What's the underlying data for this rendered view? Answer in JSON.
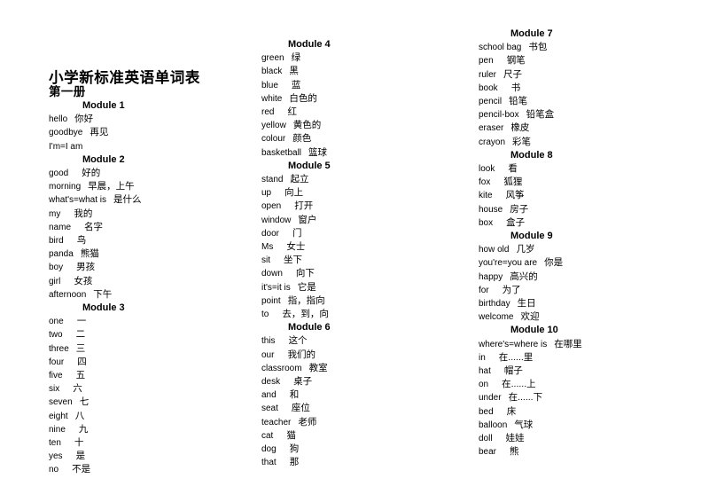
{
  "document": {
    "title": "小学新标准英语单词表",
    "subtitle": "第一册"
  },
  "columns": [
    {
      "id": "column-1",
      "modules": [
        {
          "header": "Module 1",
          "words": [
            {
              "en": "hello",
              "zh": "你好"
            },
            {
              "en": "goodbye",
              "zh": "再见"
            },
            {
              "en": "I'm=I am",
              "zh": ""
            }
          ]
        },
        {
          "header": "Module 2",
          "words": [
            {
              "en": "good",
              "zh": "好的"
            },
            {
              "en": "morning",
              "zh": "早晨，上午"
            },
            {
              "en": "what's=what is",
              "zh": "是什么"
            },
            {
              "en": "my",
              "zh": "我的"
            },
            {
              "en": "name",
              "zh": "名字"
            },
            {
              "en": "bird",
              "zh": "鸟"
            },
            {
              "en": "panda",
              "zh": "熊猫"
            },
            {
              "en": "boy",
              "zh": "男孩"
            },
            {
              "en": "girl",
              "zh": "女孩"
            },
            {
              "en": "afternoon",
              "zh": "下午"
            }
          ]
        },
        {
          "header": "Module 3",
          "words": [
            {
              "en": "one",
              "zh": "一"
            },
            {
              "en": "two",
              "zh": "二"
            },
            {
              "en": "three",
              "zh": "三"
            },
            {
              "en": "four",
              "zh": "四"
            },
            {
              "en": "five",
              "zh": "五"
            },
            {
              "en": "six",
              "zh": "六"
            },
            {
              "en": "seven",
              "zh": "七"
            },
            {
              "en": "eight",
              "zh": "八"
            },
            {
              "en": "nine",
              "zh": "九"
            },
            {
              "en": "ten",
              "zh": "十"
            },
            {
              "en": "yes",
              "zh": "是"
            },
            {
              "en": "no",
              "zh": "不是"
            }
          ]
        }
      ]
    },
    {
      "id": "column-2",
      "modules": [
        {
          "header": "Module 4",
          "words": [
            {
              "en": "green",
              "zh": "绿"
            },
            {
              "en": "black",
              "zh": "黑"
            },
            {
              "en": "blue",
              "zh": "蓝"
            },
            {
              "en": "white",
              "zh": "白色的"
            },
            {
              "en": "red",
              "zh": "红"
            },
            {
              "en": "yellow",
              "zh": "黄色的"
            },
            {
              "en": "colour",
              "zh": "颜色"
            },
            {
              "en": "basketball",
              "zh": "篮球"
            }
          ]
        },
        {
          "header": "Module 5",
          "words": [
            {
              "en": "stand",
              "zh": "起立"
            },
            {
              "en": "up",
              "zh": "向上"
            },
            {
              "en": "open",
              "zh": "打开"
            },
            {
              "en": "window",
              "zh": "窗户"
            },
            {
              "en": "door",
              "zh": "门"
            },
            {
              "en": "Ms",
              "zh": "女士"
            },
            {
              "en": "sit",
              "zh": "坐下"
            },
            {
              "en": "down",
              "zh": "向下"
            },
            {
              "en": "it's=it is",
              "zh": "它是"
            },
            {
              "en": "point",
              "zh": "指，指向"
            },
            {
              "en": "to",
              "zh": "去，到，向"
            }
          ]
        },
        {
          "header": "Module 6",
          "words": [
            {
              "en": "this",
              "zh": "这个"
            },
            {
              "en": "our",
              "zh": "我们的"
            },
            {
              "en": "classroom",
              "zh": "教室"
            },
            {
              "en": "desk",
              "zh": "桌子"
            },
            {
              "en": "and",
              "zh": "和"
            },
            {
              "en": "seat",
              "zh": "座位"
            },
            {
              "en": "teacher",
              "zh": "老师"
            },
            {
              "en": "cat",
              "zh": "猫"
            },
            {
              "en": "dog",
              "zh": "狗"
            },
            {
              "en": "that",
              "zh": "那"
            }
          ]
        }
      ]
    },
    {
      "id": "column-3",
      "modules": [
        {
          "header": "Module 7",
          "words": [
            {
              "en": "school bag",
              "zh": "书包"
            },
            {
              "en": "pen",
              "zh": "钢笔"
            },
            {
              "en": "ruler",
              "zh": "尺子"
            },
            {
              "en": "book",
              "zh": "书"
            },
            {
              "en": "pencil",
              "zh": "铅笔"
            },
            {
              "en": "pencil-box",
              "zh": "铅笔盒"
            },
            {
              "en": "eraser",
              "zh": "橡皮"
            },
            {
              "en": "crayon",
              "zh": "彩笔"
            }
          ]
        },
        {
          "header": "Module 8",
          "words": [
            {
              "en": "look",
              "zh": "看"
            },
            {
              "en": "fox",
              "zh": "狐狸"
            },
            {
              "en": "kite",
              "zh": "风筝"
            },
            {
              "en": "house",
              "zh": "房子"
            },
            {
              "en": "box",
              "zh": "盒子"
            }
          ]
        },
        {
          "header": "Module 9",
          "words": [
            {
              "en": "how old",
              "zh": "几岁"
            },
            {
              "en": "you're=you  are",
              "zh": "你是"
            },
            {
              "en": "happy",
              "zh": "高兴的"
            },
            {
              "en": "for",
              "zh": "为了"
            },
            {
              "en": "birthday",
              "zh": "生日"
            },
            {
              "en": "welcome",
              "zh": "欢迎"
            }
          ]
        },
        {
          "header": "Module 10",
          "words": [
            {
              "en": "where's=where  is",
              "zh": "在哪里"
            },
            {
              "en": "in",
              "zh": "在......里"
            },
            {
              "en": "hat",
              "zh": "帽子"
            },
            {
              "en": "on",
              "zh": "在......上"
            },
            {
              "en": "under",
              "zh": "在......下"
            },
            {
              "en": "bed",
              "zh": "床"
            },
            {
              "en": "balloon",
              "zh": "气球"
            },
            {
              "en": "doll",
              "zh": "娃娃"
            },
            {
              "en": "bear",
              "zh": "熊"
            }
          ]
        }
      ]
    }
  ]
}
